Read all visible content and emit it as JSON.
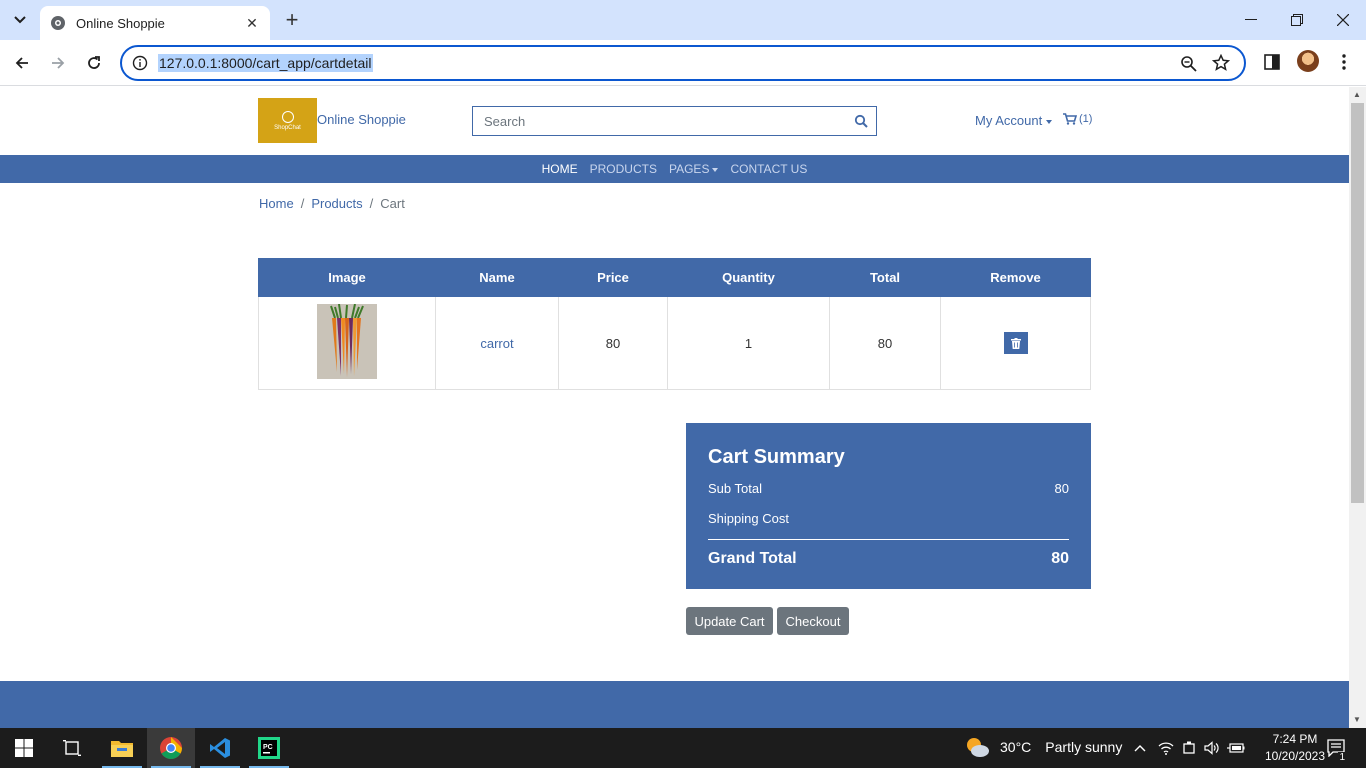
{
  "browser": {
    "tab_title": "Online Shoppie",
    "url": "127.0.0.1:8000/cart_app/cartdetail"
  },
  "site": {
    "logo_text": "ShopChat",
    "brand": "Online Shoppie",
    "search_placeholder": "Search",
    "account_label": "My Account",
    "cart_count": "(1)",
    "nav": [
      {
        "label": "HOME"
      },
      {
        "label": "PRODUCTS"
      },
      {
        "label": "PAGES"
      },
      {
        "label": "CONTACT US"
      }
    ],
    "breadcrumb": [
      "Home",
      "Products",
      "Cart"
    ]
  },
  "cart_table": {
    "headers": [
      "Image",
      "Name",
      "Price",
      "Quantity",
      "Total",
      "Remove"
    ],
    "rows": [
      {
        "name": "carrot",
        "price": "80",
        "quantity": "1",
        "total": "80"
      }
    ]
  },
  "summary": {
    "title": "Cart Summary",
    "subtotal_label": "Sub Total",
    "subtotal_value": "80",
    "shipping_label": "Shipping Cost",
    "grand_label": "Grand Total",
    "grand_value": "80"
  },
  "buttons": {
    "update": "Update Cart",
    "checkout": "Checkout"
  },
  "taskbar": {
    "weather_temp": "30°C",
    "weather_desc": "Partly sunny",
    "time": "7:24 PM",
    "date": "10/20/2023",
    "notification_count": "1"
  },
  "colors": {
    "primary": "#4169a8",
    "logo": "#d4a316",
    "button_gray": "#6c757d"
  }
}
